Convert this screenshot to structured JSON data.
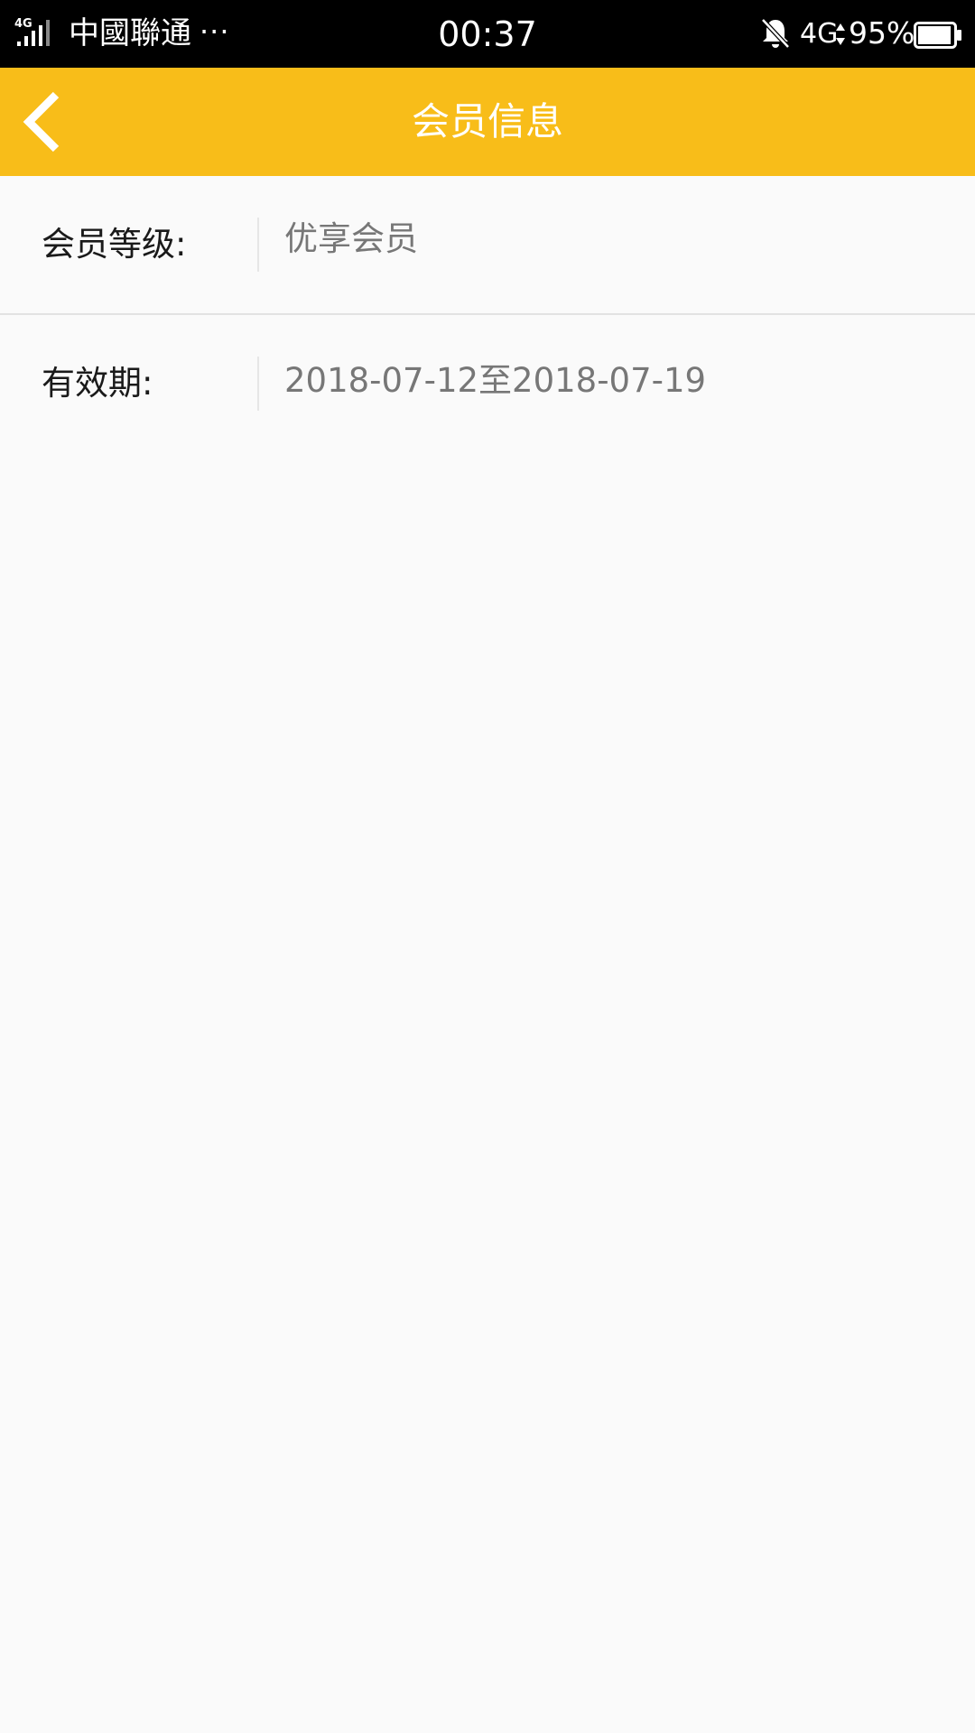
{
  "status_bar": {
    "signal_label": "4G",
    "carrier": "中國聯通",
    "more": "···",
    "time": "00:37",
    "network": "4G",
    "battery": "95%",
    "icons": [
      "signal-bars-icon",
      "mute-bell-icon",
      "data-arrows-icon",
      "battery-icon"
    ],
    "battery_level": 0.95
  },
  "header": {
    "title": "会员信息",
    "back_icon": "chevron-left-icon",
    "background_color": "#f8bd19",
    "text_color": "#ffffff"
  },
  "member_info": {
    "rows": [
      {
        "label": "会员等级:",
        "value": "优享会员"
      },
      {
        "label": "有效期:",
        "value": "2018-07-12至2018-07-19"
      }
    ]
  }
}
